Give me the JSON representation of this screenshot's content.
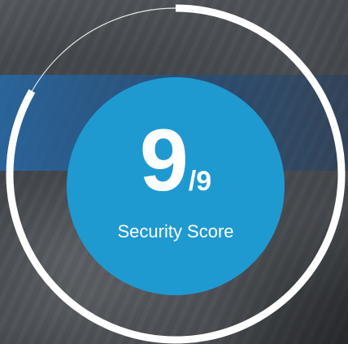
{
  "score": {
    "value": "9",
    "total": "/9",
    "label": "Security Score",
    "fraction": 1.0
  },
  "colors": {
    "circle": "#1f9ad1",
    "ring": "#ffffff",
    "band": "#216eb4"
  }
}
